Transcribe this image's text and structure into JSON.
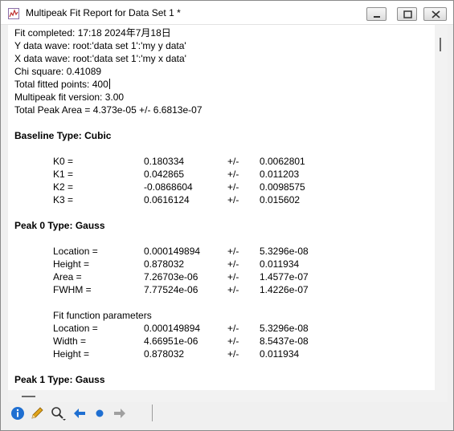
{
  "window": {
    "title": "Multipeak Fit Report for Data Set 1 *"
  },
  "report": {
    "header_lines": [
      "Fit completed: 17:18 2024年7月18日",
      "Y data wave: root:'data set 1':'my y data'",
      "X data wave: root:'data set 1':'my x data'",
      "Chi square: 0.41089",
      "Total fitted points: 400",
      "Multipeak fit version: 3.00",
      "Total Peak Area = 4.373e-05 +/- 6.6813e-07"
    ],
    "baseline": {
      "heading": "Baseline   Type: Cubic",
      "rows": [
        {
          "name": "K0 =",
          "value": "0.180334",
          "pm": "+/-",
          "error": "0.0062801"
        },
        {
          "name": "K1 =",
          "value": "0.042865",
          "pm": "+/-",
          "error": "0.011203"
        },
        {
          "name": "K2 =",
          "value": "-0.0868604",
          "pm": "+/-",
          "error": "0.0098575"
        },
        {
          "name": "K3 =",
          "value": "0.0616124",
          "pm": "+/-",
          "error": "0.015602"
        }
      ]
    },
    "peak0": {
      "heading": "Peak 0   Type: Gauss",
      "rows": [
        {
          "name": "Location =",
          "value": "0.000149894",
          "pm": "+/-",
          "error": "5.3296e-08"
        },
        {
          "name": "Height =",
          "value": "0.878032",
          "pm": "+/-",
          "error": "0.011934"
        },
        {
          "name": "Area =",
          "value": "7.26703e-06",
          "pm": "+/-",
          "error": "1.4577e-07"
        },
        {
          "name": "FWHM =",
          "value": "7.77524e-06",
          "pm": "+/-",
          "error": "1.4226e-07"
        }
      ],
      "params_heading": "Fit function parameters",
      "params": [
        {
          "name": "Location =",
          "value": "0.000149894",
          "pm": "+/-",
          "error": "5.3296e-08"
        },
        {
          "name": "Width =",
          "value": "4.66951e-06",
          "pm": "+/-",
          "error": "8.5437e-08"
        },
        {
          "name": "Height =",
          "value": "0.878032",
          "pm": "+/-",
          "error": "0.011934"
        }
      ]
    },
    "peak1": {
      "heading": "Peak 1   Type: Gauss"
    }
  },
  "toolbar": {
    "icons": [
      "info-icon",
      "pencil-icon",
      "magnifier-dropdown-icon",
      "back-arrow-icon",
      "dot-icon",
      "forward-arrow-icon"
    ],
    "colors": {
      "info": "#1f6fd1",
      "back": "#1f6fd1",
      "dot": "#1f6fd1",
      "forward": "#a0a0a0",
      "pencil": "#e0a41a"
    }
  }
}
